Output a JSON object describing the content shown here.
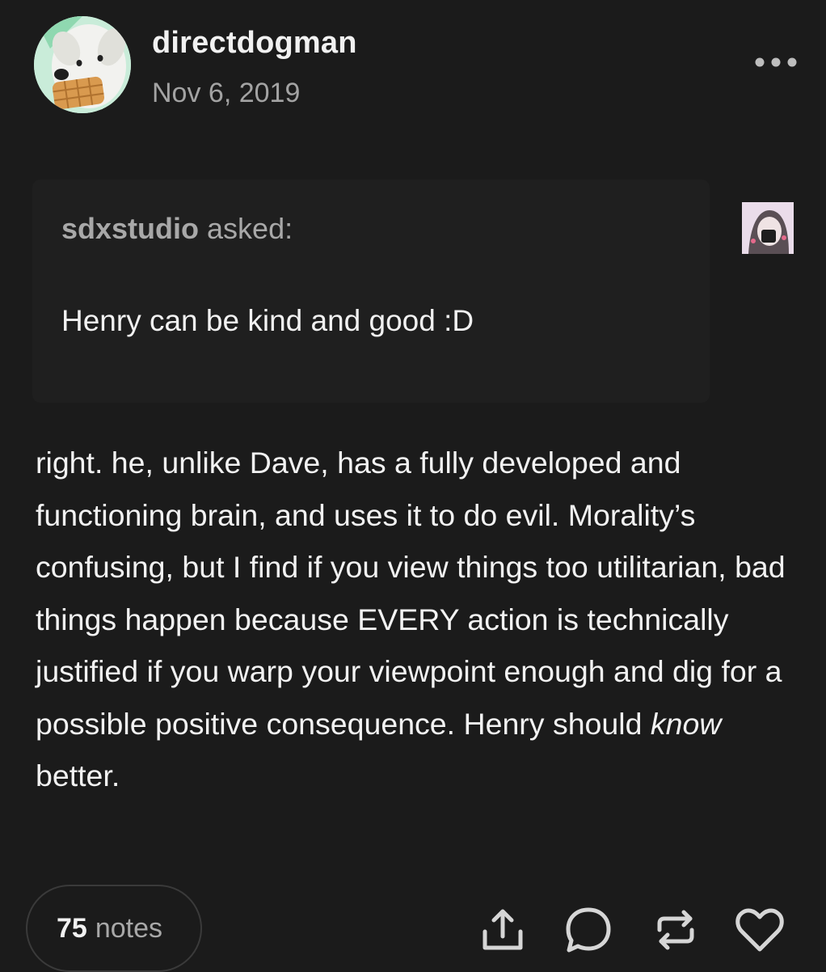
{
  "post": {
    "username": "directdogman",
    "date": "Nov 6, 2019",
    "more_icon": "more-horizontal-icon"
  },
  "ask": {
    "asker": "sdxstudio",
    "asked_label": "asked:",
    "question": "Henry can be kind and good :D"
  },
  "answer": {
    "part1": "right. he, unlike Dave, has a fully developed and functioning brain, and uses it to do evil. Morality’s confusing, but I find if you view things too utilitarian, bad things happen because EVERY action is technically justified if you warp your viewpoint enough and dig for a possible positive consequence. Henry should ",
    "emphasis": "know",
    "part2": " better."
  },
  "footer": {
    "notes_count": "75",
    "notes_label": "notes",
    "actions": [
      "share-icon",
      "reply-icon",
      "reblog-icon",
      "like-icon"
    ]
  },
  "colors": {
    "background": "#1b1b1b",
    "text_primary": "#f1f1f1",
    "text_secondary": "#a3a3a3"
  }
}
